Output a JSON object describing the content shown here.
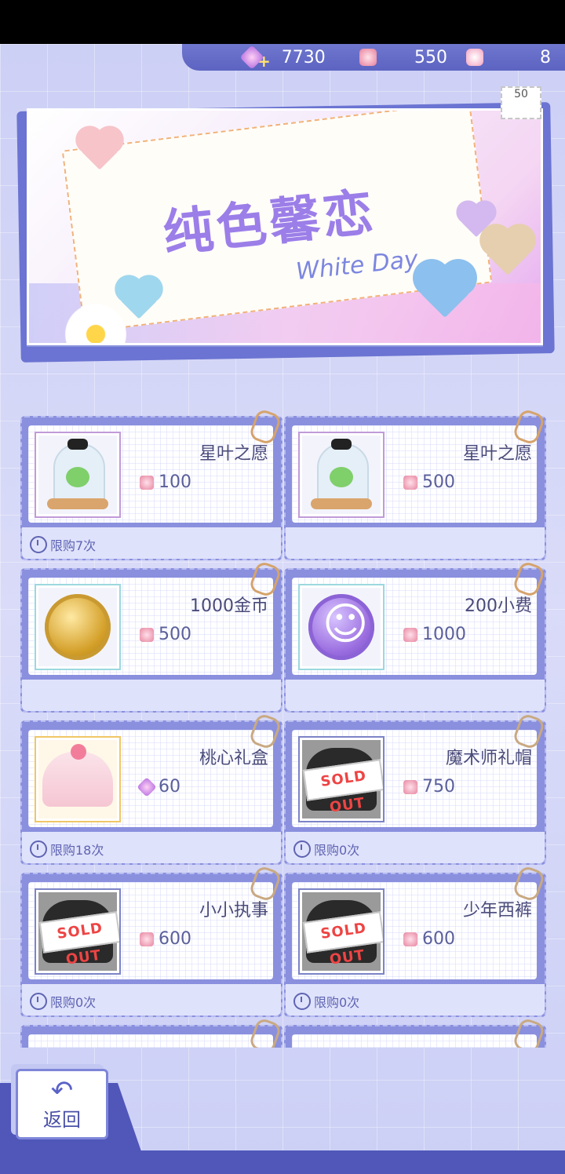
{
  "currency": {
    "diamond_value": "7730",
    "ticket_value": "550",
    "gift_value": "8"
  },
  "banner": {
    "title": "纯色馨恋",
    "subtitle": "White Day",
    "stamp": "50"
  },
  "items": [
    {
      "name": "星叶之愿",
      "price": "100",
      "limit": "限购7次",
      "sold_out": false
    },
    {
      "name": "星叶之愿",
      "price": "500",
      "limit": "",
      "sold_out": false
    },
    {
      "name": "1000金币",
      "price": "500",
      "limit": "",
      "sold_out": false
    },
    {
      "name": "200小费",
      "price": "1000",
      "limit": "",
      "sold_out": false
    },
    {
      "name": "桃心礼盒",
      "price": "60",
      "limit": "限购18次",
      "sold_out": false
    },
    {
      "name": "魔术师礼帽",
      "price": "750",
      "limit": "限购0次",
      "sold_out": true
    },
    {
      "name": "小小执事",
      "price": "600",
      "limit": "限购0次",
      "sold_out": true
    },
    {
      "name": "少年西裤",
      "price": "600",
      "limit": "限购0次",
      "sold_out": true
    }
  ],
  "sold_out_label": "SOLD OUT",
  "back_button": {
    "label": "返回"
  },
  "colors": {
    "accent": "#5c63c1",
    "price_text": "#5a5f9a",
    "name_text": "#4a4a7a"
  }
}
